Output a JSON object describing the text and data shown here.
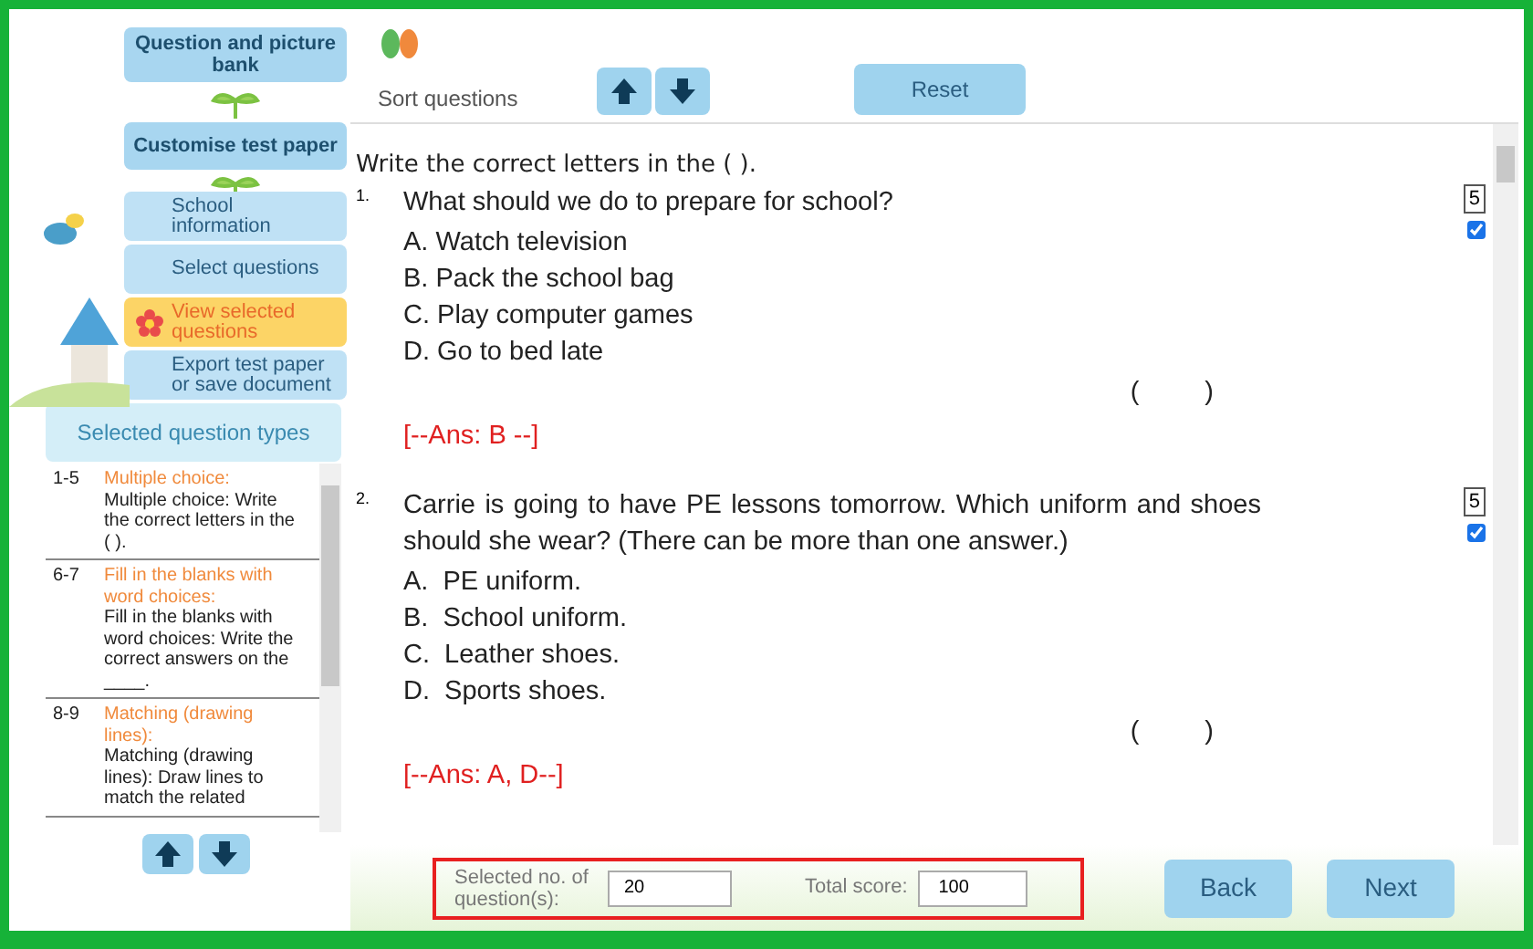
{
  "nav": {
    "headers": [
      "Question and picture bank",
      "Customise test paper"
    ],
    "steps": [
      {
        "label": "School information",
        "selected": false
      },
      {
        "label": "Select questions",
        "selected": false
      },
      {
        "label": "View selected questions",
        "selected": true
      },
      {
        "label": "Export test paper or save document",
        "selected": false
      }
    ]
  },
  "question_types": {
    "title": "Selected question types",
    "items": [
      {
        "range": "1-5",
        "title": "Multiple choice:",
        "description": "Multiple choice: Write the correct letters in the ( )."
      },
      {
        "range": "6-7",
        "title": "Fill in the blanks with word choices:",
        "description": "Fill in the blanks with word choices: Write the correct answers on the ____."
      },
      {
        "range": "8-9",
        "title": "Matching (drawing lines):",
        "description": "Matching (drawing lines): Draw lines to match the related"
      }
    ]
  },
  "sort_bar": {
    "label": "Sort questions",
    "reset": "Reset"
  },
  "instruction": "Write the correct letters in the ( ).",
  "questions": [
    {
      "number": "1.",
      "text": "What should we do to prepare for school?",
      "options": [
        "A. Watch television",
        "B. Pack the school bag",
        "C. Play computer games",
        "D. Go to bed late"
      ],
      "open": "(",
      "close": ")",
      "answer": "[--Ans: B --]",
      "score": "5",
      "checked": true
    },
    {
      "number": "2.",
      "text": "Carrie is going to have PE lessons tomorrow. Which uniform and shoes should she wear? (There can be more than one answer.)",
      "options": [
        "A.  PE uniform.",
        "B.  School uniform.",
        "C.  Leather shoes.",
        "D.  Sports shoes."
      ],
      "open": "(",
      "close": ")",
      "answer": "[--Ans: A, D--]",
      "score": "5",
      "checked": true
    }
  ],
  "footer": {
    "count_label": "Selected no. of question(s):",
    "count": "20",
    "score_label": "Total score:",
    "score": "100",
    "buttons": [
      "Back",
      "Next"
    ]
  }
}
